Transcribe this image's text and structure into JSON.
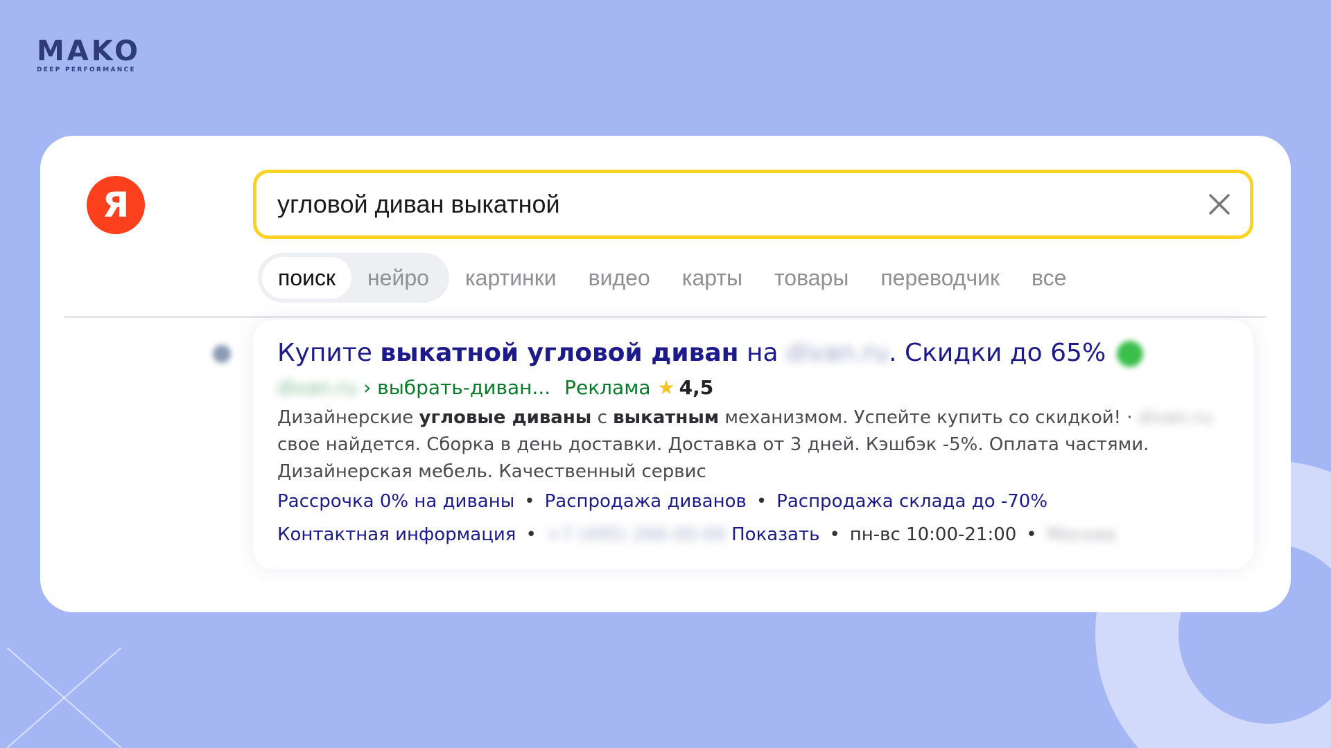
{
  "brand": {
    "name": "MAKO",
    "tagline": "DEEP PERFORMANCE"
  },
  "yandex": {
    "logo_letter": "Я",
    "logo_color": "#fc3f1d"
  },
  "search": {
    "query": "угловой диван выкатной",
    "border_color": "#fcd223"
  },
  "tabs": [
    {
      "label": "поиск",
      "active": true
    },
    {
      "label": "нейро",
      "active": false
    },
    {
      "label": "картинки",
      "active": false
    },
    {
      "label": "видео",
      "active": false
    },
    {
      "label": "карты",
      "active": false
    },
    {
      "label": "товары",
      "active": false
    },
    {
      "label": "переводчик",
      "active": false
    },
    {
      "label": "все",
      "active": false
    }
  ],
  "ad": {
    "title_prefix": "Купите ",
    "title_bold": "выкатной угловой диван",
    "title_middle": " на ",
    "title_blurred": "divan.ru",
    "title_suffix": ". Скидки до 65%",
    "url_blurred": "divan.ru",
    "url_path": " › выбрать-диван...",
    "ad_label": "Реклама",
    "star": "★",
    "rating": "4,5",
    "text_1": "Дизайнерские ",
    "text_bold_1": "угловые диваны",
    "text_2": " с ",
    "text_bold_2": "выкатным",
    "text_3": " механизмом. Успейте купить со скидкой! · ",
    "text_blurred": "divan.ru",
    "text_4": " свое найдется. Сборка в день доставки. Доставка от 3 дней. Кэшбэк -5%. Оплата частями. Дизайнерская мебель. Качественный сервис",
    "sitelinks": [
      "Рассрочка 0% на диваны",
      "Распродажа диванов",
      "Распродажа склада до -70%"
    ],
    "contact_label": "Контактная информация",
    "phone_blurred": "+7 (495) 266-00-00",
    "show_label": "Показать",
    "hours": "пн-вс 10:00-21:00",
    "city_blurred": "Москва",
    "separator": "•"
  }
}
